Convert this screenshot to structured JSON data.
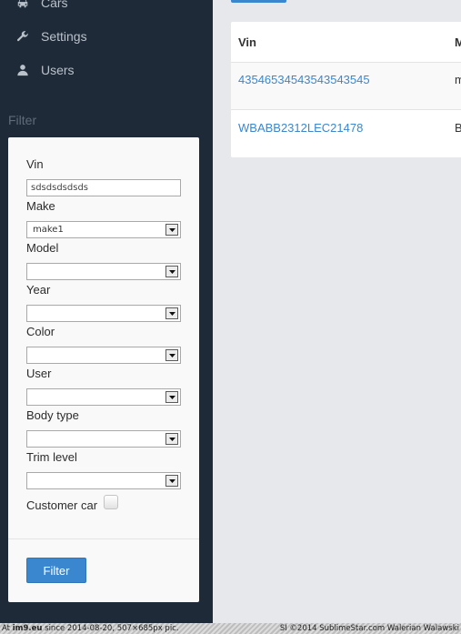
{
  "sidebar": {
    "nav": [
      {
        "label": "Cars",
        "icon": "car-icon"
      },
      {
        "label": "Settings",
        "icon": "wrench-icon"
      },
      {
        "label": "Users",
        "icon": "user-icon"
      }
    ],
    "filter_heading": "Filter"
  },
  "filter": {
    "vin_label": "Vin",
    "vin_value": "sdsdsdsdsds",
    "make_label": "Make",
    "make_value": "make1",
    "model_label": "Model",
    "model_value": "",
    "year_label": "Year",
    "year_value": "",
    "color_label": "Color",
    "color_value": "",
    "user_label": "User",
    "user_value": "",
    "body_type_label": "Body type",
    "body_type_value": "",
    "trim_level_label": "Trim level",
    "trim_level_value": "",
    "customer_car_label": "Customer car",
    "customer_car_checked": false,
    "button_label": "Filter"
  },
  "table": {
    "columns": [
      "Vin",
      "M"
    ],
    "rows": [
      {
        "vin": "43546534543543543545",
        "make": "m"
      },
      {
        "vin": "WBABB2312LEC21478",
        "make": "B"
      }
    ]
  },
  "footer": {
    "left_prefix": "At",
    "left_site": "im9.eu",
    "left_suffix": "since 2014-08-20, 507×685px pic.",
    "right": "SI ©2014 SublimeStar.com Walerian Walawski"
  },
  "colors": {
    "sidebar_bg": "#1f2a38",
    "accent": "#3a87cf",
    "page_bg": "#e6e8eb"
  }
}
